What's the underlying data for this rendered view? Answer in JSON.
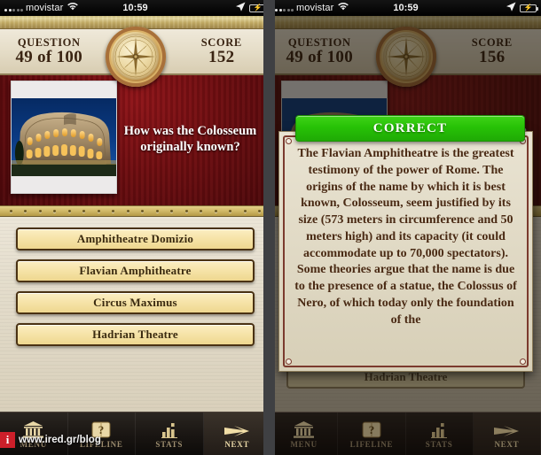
{
  "status_bar": {
    "carrier": "movistar",
    "time": "10:59",
    "wifi_icon": "wifi-icon",
    "location_icon": "location-arrow-icon",
    "battery_icon": "battery-charging-icon",
    "signal_icon": "signal-dots-icon"
  },
  "left_panel": {
    "header": {
      "question_label": "QUESTION",
      "question_value": "49 of 100",
      "score_label": "SCORE",
      "score_value": "152",
      "medallion_icon": "compass-rose-medallion-icon"
    },
    "question": {
      "text": "How was the Colosseum originally known?",
      "image_alt": "colosseum-night-photo"
    },
    "answers": [
      {
        "label": "Amphitheatre Domizio"
      },
      {
        "label": "Flavian Amphitheatre"
      },
      {
        "label": "Circus Maximus"
      },
      {
        "label": "Hadrian Theatre"
      }
    ],
    "tabbar": [
      {
        "label": "MENU",
        "icon": "temple-columns-icon",
        "active": false
      },
      {
        "label": "LIFELINE",
        "icon": "question-book-icon",
        "active": false
      },
      {
        "label": "STATS",
        "icon": "bar-chart-icon",
        "active": false
      },
      {
        "label": "NEXT",
        "icon": "arrow-right-icon",
        "active": true
      }
    ]
  },
  "right_panel": {
    "header": {
      "question_label": "QUESTION",
      "question_value": "49 of 100",
      "score_label": "SCORE",
      "score_value": "156",
      "medallion_icon": "compass-rose-medallion-icon"
    },
    "result_banner": {
      "text": "CORRECT",
      "color": "#27c206"
    },
    "explanation": "The Flavian Amphitheatre is the greatest testimony of the power of Rome. The origins of the name by which it is best known, Colosseum, seem justified by its size (573 meters in circumference and 50 meters high) and its capacity (it could accommodate up to 70,000 spectators). Some theories argue that the name is due to the presence of a statue, the Colossus of Nero, of which today only the foundation of the",
    "partial_answer_behind": "Hadrian Theatre",
    "tabbar": [
      {
        "label": "MENU",
        "icon": "temple-columns-icon",
        "active": false
      },
      {
        "label": "LIFELINE",
        "icon": "question-book-icon",
        "active": false
      },
      {
        "label": "STATS",
        "icon": "bar-chart-icon",
        "active": false
      },
      {
        "label": "NEXT",
        "icon": "arrow-right-icon",
        "active": true
      }
    ]
  },
  "watermark": {
    "badge": "i",
    "url": "www.ired.gr/blog"
  }
}
